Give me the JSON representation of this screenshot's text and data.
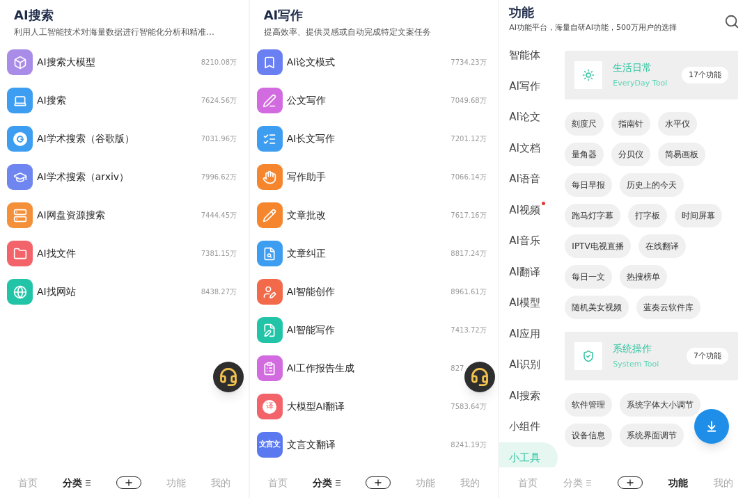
{
  "screens": [
    {
      "kind": "list",
      "title": "AI搜索",
      "subtitle": "利用人工智能技术对海量数据进行智能化分析和精准…",
      "items": [
        {
          "name": "AI搜索大模型",
          "count": "8210.08万",
          "color": "#a98be8"
        },
        {
          "name": "AI搜索",
          "count": "7624.56万",
          "color": "#3d9df0"
        },
        {
          "name": "AI学术搜索（谷歌版）",
          "count": "7031.96万",
          "color": "#3d9df0"
        },
        {
          "name": "AI学术搜索（arxiv）",
          "count": "7996.62万",
          "color": "#6f86f0"
        },
        {
          "name": "AI网盘资源搜索",
          "count": "7444.45万",
          "color": "#f5903a"
        },
        {
          "name": "AI找文件",
          "count": "7381.15万",
          "color": "#f2646a"
        },
        {
          "name": "AI找网站",
          "count": "8438.27万",
          "color": "#22c4a8"
        }
      ],
      "nav": [
        {
          "kind": "text",
          "label": "首页",
          "selected": false,
          "menu": false
        },
        {
          "kind": "text",
          "label": "分类",
          "selected": true,
          "menu": true
        },
        {
          "kind": "plus",
          "selected": false
        },
        {
          "kind": "text",
          "label": "功能",
          "selected": false,
          "menu": false
        },
        {
          "kind": "text",
          "label": "我的",
          "selected": false,
          "menu": false
        }
      ]
    },
    {
      "kind": "list",
      "title": "AI写作",
      "subtitle": "提高效率、提供灵感或自动完成特定文案任务",
      "items": [
        {
          "name": "AI论文模式",
          "count": "7734.23万",
          "color": "#6a7ff2"
        },
        {
          "name": "公文写作",
          "count": "7049.68万",
          "color": "#d36be0"
        },
        {
          "name": "AI长文写作",
          "count": "7201.12万",
          "color": "#3d9df0"
        },
        {
          "name": "写作助手",
          "count": "7066.14万",
          "color": "#f5862e"
        },
        {
          "name": "文章批改",
          "count": "7617.16万",
          "color": "#f5862e"
        },
        {
          "name": "文章纠正",
          "count": "8817.24万",
          "color": "#3d9df0"
        },
        {
          "name": "AI智能创作",
          "count": "8961.61万",
          "color": "#f26a4a"
        },
        {
          "name": "AI智能写作",
          "count": "7413.72万",
          "color": "#22c4a8"
        },
        {
          "name": "AI工作报告生成",
          "count": "827",
          "color": "#d36be0"
        },
        {
          "name": "大模型AI翻译",
          "count": "7583.64万",
          "color": "#f2646a",
          "icon_text": "译"
        },
        {
          "name": "文言文翻译",
          "count": "8241.19万",
          "color": "#5a78f0",
          "icon_text": "文言文"
        }
      ],
      "nav": [
        {
          "kind": "text",
          "label": "首页",
          "selected": false,
          "menu": false
        },
        {
          "kind": "text",
          "label": "分类",
          "selected": true,
          "menu": true
        },
        {
          "kind": "plus",
          "selected": false
        },
        {
          "kind": "text",
          "label": "功能",
          "selected": false,
          "menu": false
        },
        {
          "kind": "text",
          "label": "我的",
          "selected": false,
          "menu": false
        }
      ]
    },
    {
      "kind": "functions",
      "title": "功能",
      "subtitle": "AI功能平台，海量自研AI功能，500万用户的选择",
      "categories": [
        {
          "label": "智能体",
          "selected": false,
          "badge": false
        },
        {
          "label": "AI写作",
          "selected": false,
          "badge": false
        },
        {
          "label": "AI论文",
          "selected": false,
          "badge": false
        },
        {
          "label": "AI文档",
          "selected": false,
          "badge": false
        },
        {
          "label": "AI语音",
          "selected": false,
          "badge": false
        },
        {
          "label": "AI视频",
          "selected": false,
          "badge": true
        },
        {
          "label": "AI音乐",
          "selected": false,
          "badge": false
        },
        {
          "label": "AI翻译",
          "selected": false,
          "badge": false
        },
        {
          "label": "AI模型",
          "selected": false,
          "badge": false
        },
        {
          "label": "AI应用",
          "selected": false,
          "badge": false
        },
        {
          "label": "AI识别",
          "selected": false,
          "badge": false
        },
        {
          "label": "AI搜索",
          "selected": false,
          "badge": false
        },
        {
          "label": "小组件",
          "selected": false,
          "badge": false
        },
        {
          "label": "小工具",
          "selected": true,
          "badge": false
        }
      ],
      "sections": [
        {
          "title": "生活日常",
          "subtitle": "EveryDay Tool",
          "count": "17个功能",
          "tools": [
            "刻度尺",
            "指南针",
            "水平仪",
            "量角器",
            "分贝仪",
            "简易画板",
            "每日早报",
            "历史上的今天",
            "跑马灯字幕",
            "打字板",
            "时间屏幕",
            "IPTV电视直播",
            "在线翻译",
            "每日一文",
            "热搜榜单",
            "随机美女视频",
            "蓝奏云软件库"
          ]
        },
        {
          "title": "系统操作",
          "subtitle": "System Tool",
          "count": "7个功能",
          "tools": [
            "软件管理",
            "系统字体大小调节",
            "设备信息",
            "系统界面调节"
          ]
        }
      ],
      "nav": [
        {
          "kind": "text",
          "label": "首页",
          "selected": false,
          "menu": false
        },
        {
          "kind": "text",
          "label": "分类",
          "selected": false,
          "menu": true
        },
        {
          "kind": "plus",
          "selected": false
        },
        {
          "kind": "text",
          "label": "功能",
          "selected": true,
          "menu": false
        },
        {
          "kind": "text",
          "label": "我的",
          "selected": false,
          "menu": false
        }
      ]
    }
  ]
}
